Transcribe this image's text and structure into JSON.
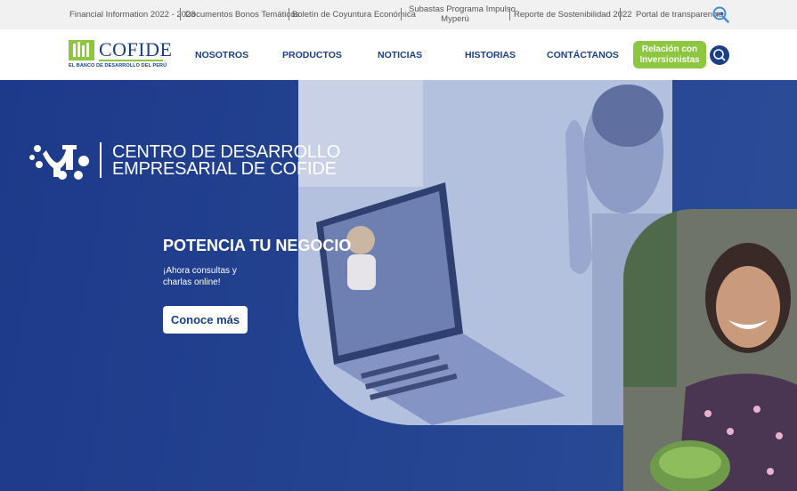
{
  "topbar": {
    "links": [
      "Financial Information 2022 - 2023",
      "Documentos Bonos Temáticos",
      "Boletín de Coyuntura Económica",
      "Subastas Programa Impulso",
      "Myperú",
      "Reporte de Sostenibilidad 2022",
      "Portal de transparencia"
    ],
    "gob_icon_label": "gob"
  },
  "brand": {
    "name": "COFIDE",
    "tagline": "EL BANCO DE DESARROLLO DEL PERÚ",
    "primary_color": "#1a3f87",
    "accent_color": "#8dc63f"
  },
  "nav": {
    "items": [
      "NOSOTROS",
      "PRODUCTOS",
      "NOTICIAS",
      "HISTORIAS",
      "CONTÁCTANOS"
    ],
    "cta_line1": "Relación con",
    "cta_line2": "Inversionistas",
    "search_icon": "search-icon"
  },
  "hero": {
    "program_line1": "CENTRO DE DESARROLLO",
    "program_line2": "EMPRESARIAL DE COFIDE",
    "title": "POTENCIA TU NEGOCIO",
    "subtitle_line1": "¡Ahora consultas y",
    "subtitle_line2": "charlas online!",
    "button": "Conoce más",
    "background_color": "#223f8e"
  }
}
